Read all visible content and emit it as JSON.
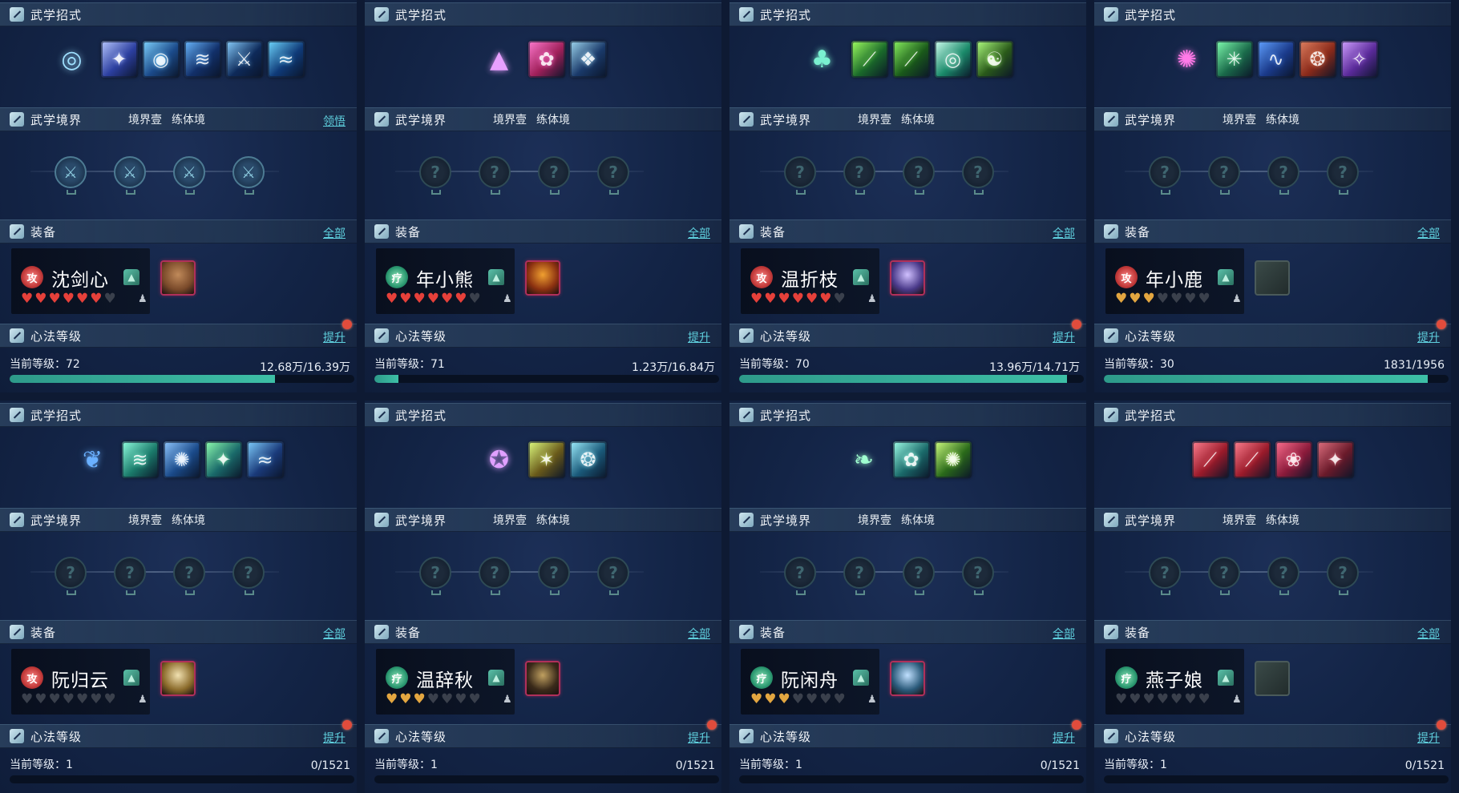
{
  "labels": {
    "skills": "武学招式",
    "realm": "武学境界",
    "realm_stage": "境界壹",
    "realm_type": "练体境",
    "equip": "装备",
    "equip_all": "全部",
    "heart_method": "心法等级",
    "upgrade": "提升",
    "current_level_prefix": "当前等级：",
    "comprehend": "领悟"
  },
  "role_chars": {
    "atk": "攻",
    "heal": "疗"
  },
  "characters": [
    {
      "name": "沈剑心",
      "role": "atk",
      "realm_link": "领悟",
      "hearts": [
        "red",
        "red",
        "red",
        "red",
        "red",
        "red",
        "empty"
      ],
      "level": "72",
      "exp": "12.68万/16.39万",
      "progress": 0.77,
      "upgrade_dot": true,
      "skills": [
        {
          "color": "#2a6aa8",
          "color2": "#9fe0ff",
          "glyph": "◎",
          "first": true
        },
        {
          "color": "#2c3fa0",
          "color2": "#b8c8ff",
          "glyph": "✦"
        },
        {
          "color": "#1b4a8a",
          "color2": "#7fd4ff",
          "glyph": "◉"
        },
        {
          "color": "#12306a",
          "color2": "#6ab8ff",
          "glyph": "≋"
        },
        {
          "color": "#0e2a5a",
          "color2": "#8ad0ff",
          "glyph": "⚔"
        },
        {
          "color": "#0f3a78",
          "color2": "#6fd8ff",
          "glyph": "≈"
        }
      ],
      "nodes_lit": [
        true,
        true,
        true,
        true
      ],
      "gear": {
        "color": "#7a4a2a",
        "color2": "#c08a5a"
      }
    },
    {
      "name": "年小熊",
      "role": "heal",
      "realm_link": "",
      "hearts": [
        "red",
        "red",
        "red",
        "red",
        "red",
        "red",
        "empty"
      ],
      "level": "71",
      "exp": "1.23万/16.84万",
      "progress": 0.07,
      "upgrade_dot": false,
      "skills": [
        {
          "color": "#7a2aa0",
          "color2": "#e8a0ff",
          "glyph": "▲",
          "first": true
        },
        {
          "color": "#a0205a",
          "color2": "#ff7ad0",
          "glyph": "✿"
        },
        {
          "color": "#1a3a6a",
          "color2": "#a0d8f0",
          "glyph": "❖"
        }
      ],
      "nodes_lit": [
        false,
        false,
        false,
        false
      ],
      "gear": {
        "color": "#8a3010",
        "color2": "#f0a030"
      }
    },
    {
      "name": "温折枝",
      "role": "atk",
      "realm_link": "",
      "hearts": [
        "red",
        "red",
        "red",
        "red",
        "red",
        "red",
        "empty"
      ],
      "level": "70",
      "exp": "13.96万/14.71万",
      "progress": 0.95,
      "upgrade_dot": true,
      "skills": [
        {
          "color": "#1a7a6a",
          "color2": "#7af0d0",
          "glyph": "♣",
          "first": true
        },
        {
          "color": "#1a6a2a",
          "color2": "#a0ff60",
          "glyph": "⟋"
        },
        {
          "color": "#1a5a1a",
          "color2": "#8af060",
          "glyph": "⟋"
        },
        {
          "color": "#1a8a6a",
          "color2": "#d0fff0",
          "glyph": "◎"
        },
        {
          "color": "#2a5a1a",
          "color2": "#b0ff80",
          "glyph": "☯"
        }
      ],
      "nodes_lit": [
        false,
        false,
        false,
        false
      ],
      "gear": {
        "color": "#4a3a8a",
        "color2": "#d0c0ff"
      }
    },
    {
      "name": "年小鹿",
      "role": "atk",
      "realm_link": "",
      "hearts": [
        "gold",
        "gold",
        "gold",
        "empty",
        "empty",
        "empty",
        "empty"
      ],
      "level": "30",
      "exp": "1831/1956",
      "progress": 0.94,
      "upgrade_dot": true,
      "skills": [
        {
          "color": "#8a1a8a",
          "color2": "#ff7ae8",
          "glyph": "✺",
          "first": true
        },
        {
          "color": "#1a6a4a",
          "color2": "#80ffb0",
          "glyph": "✳"
        },
        {
          "color": "#1a3a8a",
          "color2": "#60a0ff",
          "glyph": "∿"
        },
        {
          "color": "#8a2a1a",
          "color2": "#e08060",
          "glyph": "❂"
        },
        {
          "color": "#5a2a9a",
          "color2": "#d0a0ff",
          "glyph": "✧"
        }
      ],
      "nodes_lit": [
        false,
        false,
        false,
        false
      ],
      "gear": null
    },
    {
      "name": "阮归云",
      "role": "atk",
      "realm_link": "",
      "hearts": [
        "empty",
        "empty",
        "empty",
        "empty",
        "empty",
        "empty",
        "empty"
      ],
      "level": "1",
      "exp": "0/1521",
      "progress": 0.0,
      "upgrade_dot": true,
      "skills": [
        {
          "color": "#1a4a9a",
          "color2": "#6ab0ff",
          "glyph": "❦",
          "first": true
        },
        {
          "color": "#1a7a6a",
          "color2": "#90ffe0",
          "glyph": "≋"
        },
        {
          "color": "#1a4a8a",
          "color2": "#90c8ff",
          "glyph": "✺"
        },
        {
          "color": "#1a6a6a",
          "color2": "#90ffb0",
          "glyph": "✦"
        },
        {
          "color": "#1a3a7a",
          "color2": "#80d0ff",
          "glyph": "≈"
        }
      ],
      "nodes_lit": [
        false,
        false,
        false,
        false
      ],
      "gear": {
        "color": "#8a6a2a",
        "color2": "#f0e0b0"
      }
    },
    {
      "name": "温辞秋",
      "role": "heal",
      "realm_link": "",
      "hearts": [
        "gold",
        "gold",
        "gold",
        "empty",
        "empty",
        "empty",
        "empty"
      ],
      "level": "1",
      "exp": "0/1521",
      "progress": 0.0,
      "upgrade_dot": true,
      "skills": [
        {
          "color": "#6a1a8a",
          "color2": "#e0a0ff",
          "glyph": "✪",
          "first": true
        },
        {
          "color": "#6a5a1a",
          "color2": "#e0ff80",
          "glyph": "✶"
        },
        {
          "color": "#1a5a7a",
          "color2": "#a0f0ff",
          "glyph": "❂"
        }
      ],
      "nodes_lit": [
        false,
        false,
        false,
        false
      ],
      "gear": {
        "color": "#3a2a1a",
        "color2": "#c0a060"
      }
    },
    {
      "name": "阮闲舟",
      "role": "heal",
      "realm_link": "",
      "hearts": [
        "gold",
        "gold",
        "gold",
        "empty",
        "empty",
        "empty",
        "empty"
      ],
      "level": "1",
      "exp": "0/1521",
      "progress": 0.0,
      "upgrade_dot": true,
      "skills": [
        {
          "color": "#1a7a5a",
          "color2": "#a0ffd0",
          "glyph": "❧",
          "first": true
        },
        {
          "color": "#1a6a6a",
          "color2": "#a0ffe8",
          "glyph": "✿"
        },
        {
          "color": "#2a6a1a",
          "color2": "#d0ff80",
          "glyph": "✺"
        }
      ],
      "nodes_lit": [
        false,
        false,
        false,
        false
      ],
      "gear": {
        "color": "#2a5a7a",
        "color2": "#c0e0ff"
      }
    },
    {
      "name": "燕子娘",
      "role": "heal",
      "realm_link": "",
      "hearts": [
        "empty",
        "empty",
        "empty",
        "empty",
        "empty",
        "empty",
        "empty"
      ],
      "level": "1",
      "exp": "0/1521",
      "progress": 0.0,
      "upgrade_dot": true,
      "skills": [
        {
          "color": "#9a1a2a",
          "color2": "#ff8090",
          "glyph": "⟋"
        },
        {
          "color": "#9a1a2a",
          "color2": "#ff8090",
          "glyph": "⟋"
        },
        {
          "color": "#8a1a3a",
          "color2": "#ff7090",
          "glyph": "❀"
        },
        {
          "color": "#6a1a2a",
          "color2": "#e07080",
          "glyph": "✦"
        }
      ],
      "nodes_lit": [
        false,
        false,
        false,
        false
      ],
      "gear": null
    }
  ]
}
